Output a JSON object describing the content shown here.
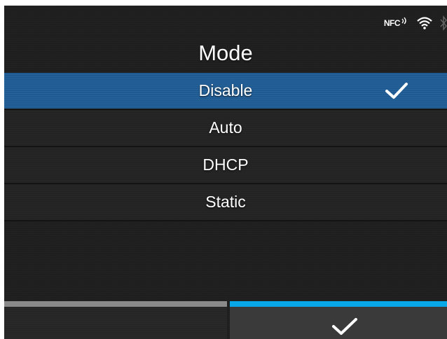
{
  "header": {
    "title": "Mode",
    "status_icons": [
      "nfc-icon",
      "wifi-icon",
      "bluetooth-icon"
    ],
    "nfc_label": "NFC"
  },
  "options": [
    {
      "label": "Disable",
      "selected": true
    },
    {
      "label": "Auto",
      "selected": false
    },
    {
      "label": "DHCP",
      "selected": false
    },
    {
      "label": "Static",
      "selected": false
    }
  ],
  "footer": {
    "left_button": {
      "label": ""
    },
    "right_button": {
      "icon": "checkmark-icon"
    }
  },
  "colors": {
    "background": "#1f1f1f",
    "selected_row": "#1f5b93",
    "footer_left_bar": "#8a8a8a",
    "footer_right_bar": "#08a8e8"
  }
}
